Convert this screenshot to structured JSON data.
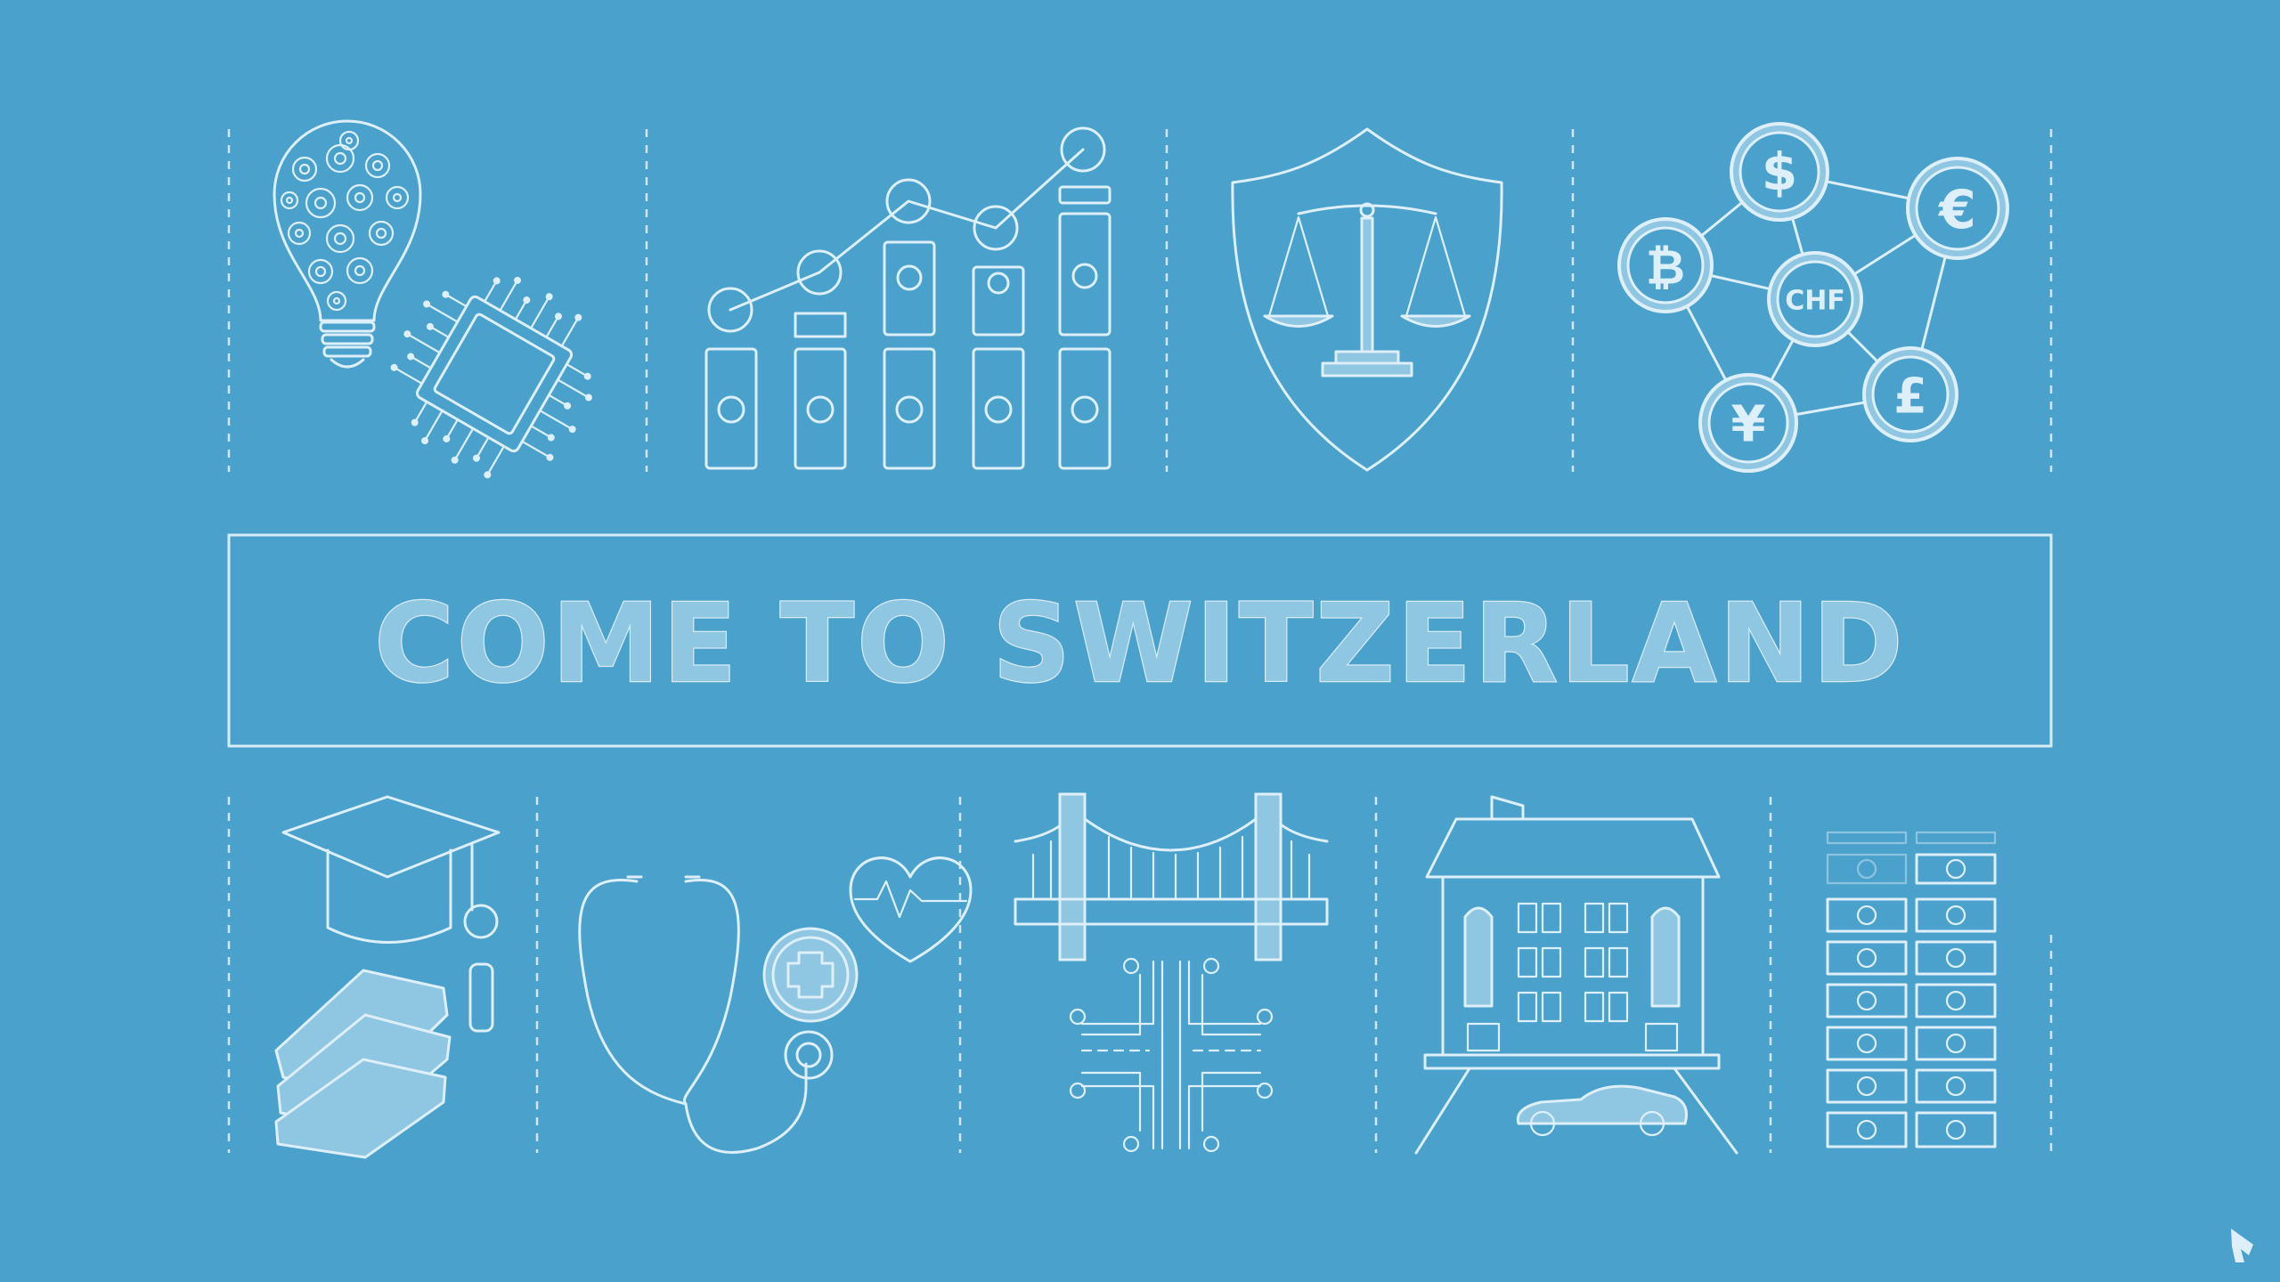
{
  "headline": "COME TO SWITZERLAND",
  "currencies": {
    "dollar": "$",
    "euro": "€",
    "bitcoin": "₿",
    "franc": "CHF",
    "pound": "£",
    "yen": "¥"
  },
  "colors": {
    "background": "#4aa1cb",
    "line": "#ddeff8",
    "fill": "#8fc6e1"
  },
  "icons": [
    "lightbulb-gears-icon",
    "microchip-icon",
    "money-growth-chart-icon",
    "justice-shield-icon",
    "currency-network-icon",
    "graduation-books-icon",
    "stethoscope-heart-icon",
    "bridge-roads-icon",
    "building-car-icon",
    "money-stacks-icon",
    "logo-icon"
  ]
}
